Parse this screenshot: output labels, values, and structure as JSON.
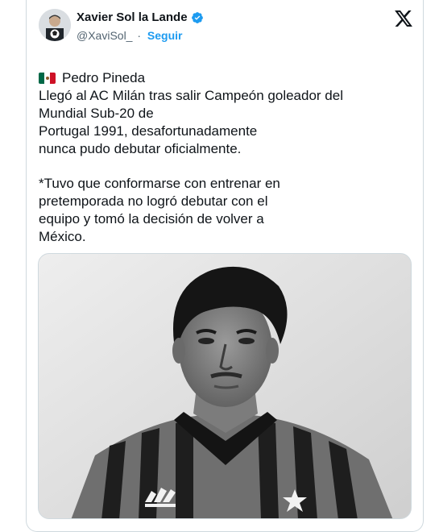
{
  "author": {
    "name": "Xavier Sol la Lande",
    "handle": "@XaviSol_",
    "separator": "·",
    "follow_label": "Seguir",
    "verified": true,
    "verified_color": "#1d9bf0"
  },
  "platform_icon": "x-logo-icon",
  "tweet": {
    "flag_icon": "mexico-flag-icon",
    "line1": "Pedro Pineda",
    "para1": "Llegó al AC Milán tras salir Campeón goleador del Mundial Sub-20 de\nPortugal 1991, desafortunadamente\nnunca pudo debutar oficialmente.",
    "para2": "*Tuvo que conformarse con entrenar en\npretemporada no logró debutar con el\nequipo y tomó la decisión de volver a\nMéxico."
  },
  "media": {
    "type": "photo",
    "style": "black-and-white"
  },
  "colors": {
    "text": "#0f1419",
    "secondary": "#536471",
    "accent": "#1d9bf0",
    "border": "#cfd9de"
  }
}
